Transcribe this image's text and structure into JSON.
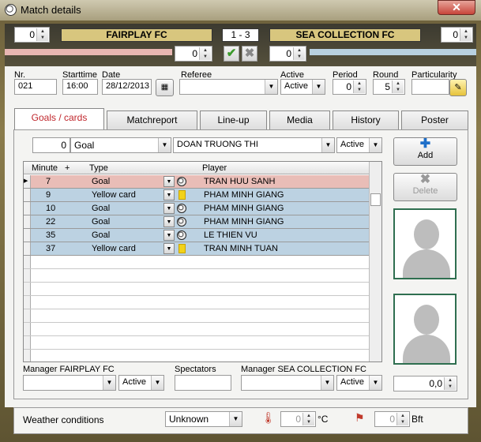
{
  "window": {
    "title": "Match details",
    "close": "✕"
  },
  "header": {
    "home_spin": "0",
    "home_team": "FAIRPLAY FC",
    "score": "1  -  3",
    "away_team": "SEA COLLECTION FC",
    "away_spin": "0",
    "home_sub_spin": "0",
    "away_sub_spin": "0",
    "confirm_icon": "✔",
    "cancel_icon": "✖"
  },
  "info": {
    "nr_label": "Nr.",
    "nr": "021",
    "starttime_label": "Starttime",
    "starttime": "16:00",
    "date_label": "Date",
    "date": "28/12/2013",
    "referee_label": "Referee",
    "referee": "",
    "active_label": "Active",
    "active": "Active",
    "period_label": "Period",
    "period": "0",
    "round_label": "Round",
    "round": "5",
    "particularity_label": "Particularity",
    "particularity": ""
  },
  "tabs": [
    "Goals / cards",
    "Matchreport",
    "Line-up",
    "Media",
    "History",
    "Poster"
  ],
  "filter": {
    "minute": "0",
    "type": "Goal",
    "player": "DOAN TRUONG THI",
    "status": "Active"
  },
  "grid": {
    "col_minute": "Minute",
    "col_plus": "+",
    "col_type": "Type",
    "col_player": "Player",
    "rows": [
      {
        "minute": "7",
        "type": "Goal",
        "player": "TRAN HUU SANH",
        "kind": "ball",
        "bg": "#e9bdb7"
      },
      {
        "minute": "9",
        "type": "Yellow card",
        "player": "PHAM MINH GIANG",
        "kind": "card",
        "bg": "#bcd2e2"
      },
      {
        "minute": "10",
        "type": "Goal",
        "player": "PHAM MINH GIANG",
        "kind": "ball",
        "bg": "#bcd2e2"
      },
      {
        "minute": "22",
        "type": "Goal",
        "player": "PHAM MINH GIANG",
        "kind": "ball",
        "bg": "#bcd2e2"
      },
      {
        "minute": "35",
        "type": "Goal",
        "player": "LE THIEN VU",
        "kind": "ball",
        "bg": "#bcd2e2"
      },
      {
        "minute": "37",
        "type": "Yellow card",
        "player": "TRAN MINH TUAN",
        "kind": "card",
        "bg": "#bcd2e2"
      }
    ]
  },
  "actions": {
    "add": "Add",
    "delete": "Delete",
    "rating": "0,0"
  },
  "managers": {
    "home_label": "Manager FAIRPLAY FC",
    "home_status": "Active",
    "spectators_label": "Spectators",
    "away_label": "Manager SEA COLLECTION FC",
    "away_status": "Active"
  },
  "weather": {
    "label": "Weather conditions",
    "condition": "Unknown",
    "temp": "0",
    "temp_unit": "°C",
    "wind": "0",
    "wind_unit": "Bft"
  }
}
